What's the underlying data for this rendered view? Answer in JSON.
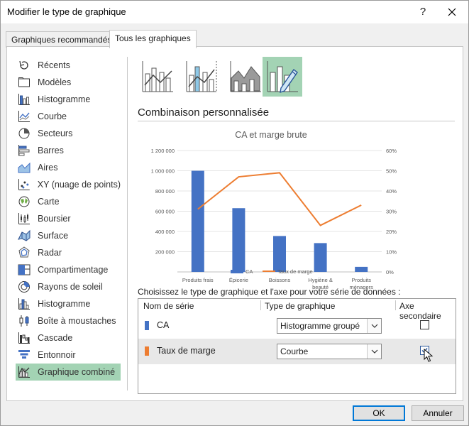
{
  "window": {
    "title": "Modifier le type de graphique",
    "help": "?",
    "close": "✕"
  },
  "tabs": [
    {
      "label": "Graphiques recommandés",
      "active": false
    },
    {
      "label": "Tous les graphiques",
      "active": true
    }
  ],
  "sidebar": {
    "items": [
      {
        "label": "Récents",
        "icon": "recent-icon"
      },
      {
        "label": "Modèles",
        "icon": "folder-icon"
      },
      {
        "label": "Histogramme",
        "icon": "column-chart-icon"
      },
      {
        "label": "Courbe",
        "icon": "line-chart-icon"
      },
      {
        "label": "Secteurs",
        "icon": "pie-chart-icon"
      },
      {
        "label": "Barres",
        "icon": "bar-chart-icon"
      },
      {
        "label": "Aires",
        "icon": "area-chart-icon"
      },
      {
        "label": "XY (nuage de points)",
        "icon": "scatter-chart-icon"
      },
      {
        "label": "Carte",
        "icon": "map-chart-icon"
      },
      {
        "label": "Boursier",
        "icon": "stock-chart-icon"
      },
      {
        "label": "Surface",
        "icon": "surface-chart-icon"
      },
      {
        "label": "Radar",
        "icon": "radar-chart-icon"
      },
      {
        "label": "Compartimentage",
        "icon": "treemap-chart-icon"
      },
      {
        "label": "Rayons de soleil",
        "icon": "sunburst-chart-icon"
      },
      {
        "label": "Histogramme",
        "icon": "histogram-chart-icon"
      },
      {
        "label": "Boîte à moustaches",
        "icon": "box-whisker-chart-icon"
      },
      {
        "label": "Cascade",
        "icon": "waterfall-chart-icon"
      },
      {
        "label": "Entonnoir",
        "icon": "funnel-chart-icon"
      },
      {
        "label": "Graphique combiné",
        "icon": "combo-chart-icon",
        "selected": true
      }
    ]
  },
  "main": {
    "section_title": "Combinaison personnalisée",
    "series_prompt": "Choisissez le type de graphique et l'axe pour votre série de données :",
    "table": {
      "headers": [
        "Nom de série",
        "Type de graphique",
        "Axe secondaire"
      ],
      "rows": [
        {
          "name": "CA",
          "type": "Histogramme groupé",
          "secondary": false,
          "color": "#4472c4"
        },
        {
          "name": "Taux de marge",
          "type": "Courbe",
          "secondary": true,
          "color": "#ed7d31"
        }
      ]
    }
  },
  "buttons": {
    "ok": "OK",
    "cancel": "Annuler"
  },
  "colors": {
    "accent": "#a3d3b4",
    "bar": "#4472c4",
    "line": "#ed7d31"
  },
  "chart_data": {
    "type": "bar+line",
    "title": "CA et marge brute",
    "categories": [
      "Produits frais",
      "Épicerie",
      "Boissons",
      "Hygiène & beauté",
      "Produits ménagers"
    ],
    "series": [
      {
        "name": "CA",
        "type": "bar",
        "axis": "primary",
        "values": [
          1000000,
          630000,
          355000,
          285000,
          50000
        ]
      },
      {
        "name": "Taux de marge",
        "type": "line",
        "axis": "secondary",
        "values": [
          0.31,
          0.47,
          0.49,
          0.23,
          0.33
        ]
      }
    ],
    "y_ticks": [
      "",
      "200 000",
      "400 000",
      "600 000",
      "800 000",
      "1 000 000",
      "1 200 000"
    ],
    "y2_ticks": [
      "0%",
      "10%",
      "20%",
      "30%",
      "40%",
      "50%",
      "60%"
    ],
    "ylim": [
      0,
      1200000
    ],
    "y2lim": [
      0,
      0.6
    ],
    "legend": "bottom"
  }
}
